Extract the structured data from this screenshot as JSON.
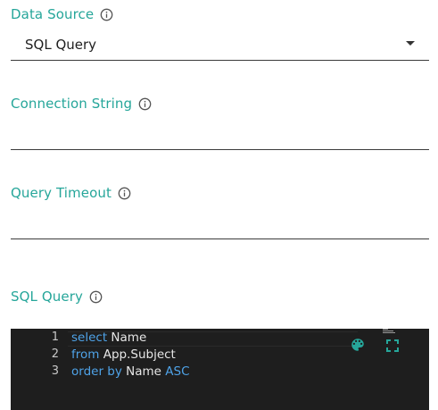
{
  "colors": {
    "accent": "#26a69a",
    "editor_bg": "#1e1e1e",
    "keyword": "#4fa3e8"
  },
  "data_source": {
    "label": "Data Source",
    "value": "SQL Query",
    "info_icon": "info-circle-icon",
    "dropdown_icon": "caret-down-icon"
  },
  "connection_string": {
    "label": "Connection String",
    "value": "",
    "info_icon": "info-circle-icon"
  },
  "query_timeout": {
    "label": "Query Timeout",
    "value": "",
    "info_icon": "info-circle-icon"
  },
  "sql_query": {
    "label": "SQL Query",
    "info_icon": "info-circle-icon",
    "editor": {
      "lines": [
        {
          "number": "1",
          "tokens": [
            {
              "text": "select",
              "kw": true
            },
            {
              "text": " Name",
              "kw": false
            }
          ]
        },
        {
          "number": "2",
          "tokens": [
            {
              "text": "from",
              "kw": true
            },
            {
              "text": " App.Subject",
              "kw": false
            }
          ]
        },
        {
          "number": "3",
          "tokens": [
            {
              "text": "order by",
              "kw": true
            },
            {
              "text": " Name ",
              "kw": false
            },
            {
              "text": "ASC",
              "kw": true
            }
          ]
        }
      ],
      "theme_icon": "palette-icon",
      "fullscreen_icon": "fullscreen-icon"
    }
  }
}
